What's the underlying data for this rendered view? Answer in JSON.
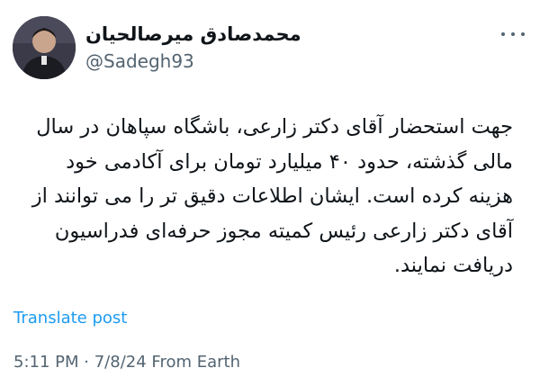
{
  "author": {
    "display_name": "محمدصادق میرصالحیان",
    "handle": "@Sadegh93",
    "avatar_icon": "profile-photo"
  },
  "menu": {
    "icon": "more-horizontal-icon"
  },
  "tweet": {
    "lines": [
      "جهت استحضار آقای دکتر زارعی، باشگاه سپاهان در سال",
      "مالی گذشته، حدود ۴۰ میلیارد تومان برای آکادمی خود",
      "هزینه کرده است. ایشان اطلاعات دقیق تر را می توانند از",
      "آقای دکتر زارعی رئیس کمیته مجوز حرفه‌ای فدراسیون",
      "دریافت نمایند."
    ]
  },
  "translate_label": "Translate post",
  "meta": {
    "time": "5:11 PM",
    "separator": "·",
    "date": "7/8/24",
    "source": "From Earth"
  },
  "colors": {
    "text": "#0f1419",
    "secondary": "#536471",
    "link": "#1d9bf0"
  }
}
